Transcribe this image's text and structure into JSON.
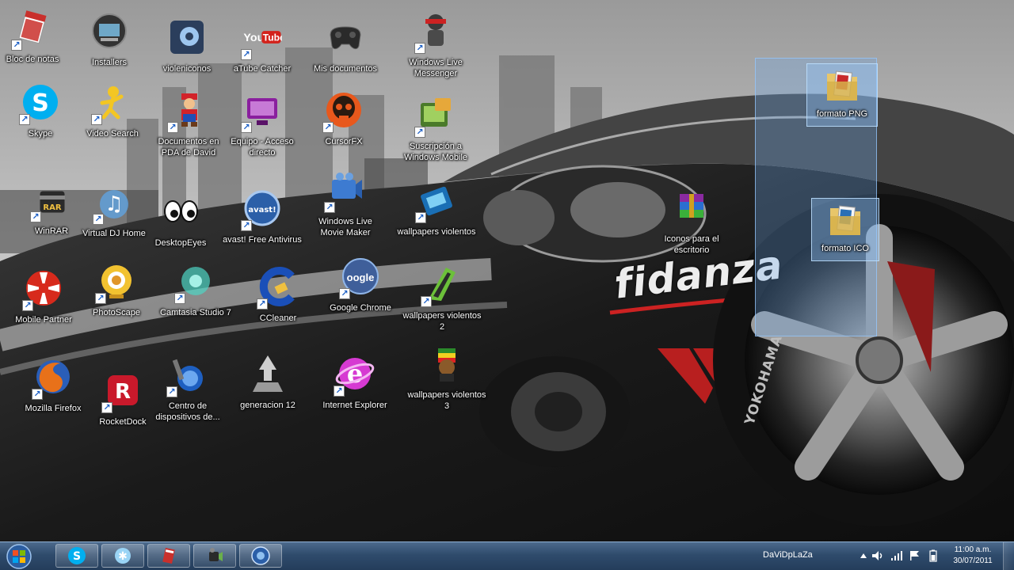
{
  "desktop": {
    "icons": [
      {
        "label": "Bloc de notas"
      },
      {
        "label": "Installers"
      },
      {
        "label": "violeniconos"
      },
      {
        "label": "aTube Catcher"
      },
      {
        "label": "Mis documentos"
      },
      {
        "label": "Windows Live Messenger"
      },
      {
        "label": "Skype"
      },
      {
        "label": "Video Search"
      },
      {
        "label": "Documentos en PDA de David"
      },
      {
        "label": "Equipo - Acceso directo"
      },
      {
        "label": "CursorFX"
      },
      {
        "label": "Suscripción a Windows Mobile"
      },
      {
        "label": "WinRAR"
      },
      {
        "label": "Virtual DJ Home"
      },
      {
        "label": "DesktopEyes"
      },
      {
        "label": "avast! Free Antivirus"
      },
      {
        "label": "Windows Live Movie Maker"
      },
      {
        "label": "wallpapers violentos"
      },
      {
        "label": "Iconos para el escritorio"
      },
      {
        "label": "Mobile Partner"
      },
      {
        "label": "PhotoScape"
      },
      {
        "label": "Camtasia Studio 7"
      },
      {
        "label": "CCleaner"
      },
      {
        "label": "Google Chrome"
      },
      {
        "label": "wallpapers violentos 2"
      },
      {
        "label": "Mozilla Firefox"
      },
      {
        "label": "RocketDock"
      },
      {
        "label": "Centro de dispositivos de..."
      },
      {
        "label": "generacion 12"
      },
      {
        "label": "Internet Explorer"
      },
      {
        "label": "wallpapers violentos 3"
      }
    ],
    "selected_folders": [
      {
        "label": "formato PNG"
      },
      {
        "label": "formato ICO"
      }
    ],
    "wallpaper_text": {
      "brand": "fidanza",
      "sponsor": "YOKOHAMA"
    },
    "yt_logo": {
      "you": "You",
      "tube": "Tube"
    }
  },
  "taskbar": {
    "toolbar_label": "DaViDpLaZa",
    "clock": {
      "time": "11:00 a.m.",
      "date": "30/07/2011"
    },
    "pinned": [
      {
        "icon": "skype-icon"
      },
      {
        "icon": "snowflake-icon"
      },
      {
        "icon": "notepad-icon"
      },
      {
        "icon": "camtasia-icon"
      },
      {
        "icon": "avast-icon"
      }
    ]
  },
  "colors": {
    "taskbar": "#2f4b6c",
    "selection": "#6eaaeb",
    "skype": "#00aff0"
  }
}
